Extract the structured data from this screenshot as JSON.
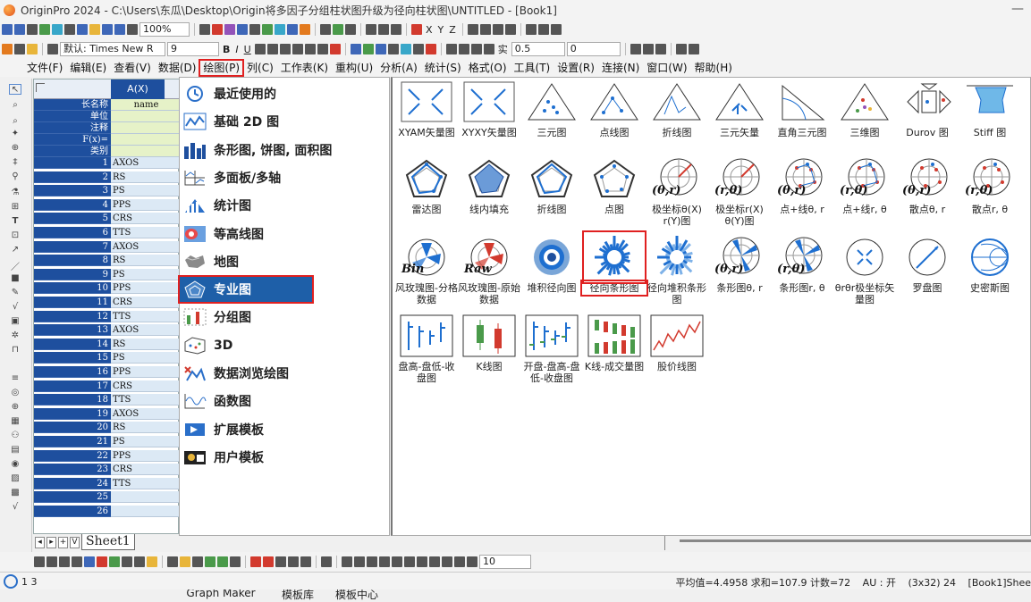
{
  "window": {
    "title": "OriginPro 2024 - C:\\Users\\东瓜\\Desktop\\Origin将多因子分组柱状图升级为径向柱状图\\UNTITLED - [Book1]",
    "minimize": "—"
  },
  "toolbar1": {
    "zoom": "100%",
    "text_items": [
      "X",
      "Y",
      "Z"
    ]
  },
  "toolbar2": {
    "font_name": "默认: Times New R",
    "font_size": "9",
    "bold": "B",
    "italic": "I",
    "underline": "U",
    "line_label": "实",
    "line_width": "0.5",
    "pattern_value": "0"
  },
  "menubar": {
    "items": [
      "文件(F)",
      "编辑(E)",
      "查看(V)",
      "数据(D)",
      "绘图(P)",
      "列(C)",
      "工作表(K)",
      "重构(U)",
      "分析(A)",
      "统计(S)",
      "格式(O)",
      "工具(T)",
      "设置(R)",
      "连接(N)",
      "窗口(W)",
      "帮助(H)"
    ],
    "active_index": 4
  },
  "sheet": {
    "column_header": "A(X)",
    "meta_rows": [
      {
        "label": "长名称",
        "value": "name"
      },
      {
        "label": "单位",
        "value": ""
      },
      {
        "label": "注释",
        "value": ""
      },
      {
        "label": "F(x)=",
        "value": ""
      },
      {
        "label": "类别",
        "value": ""
      }
    ],
    "rows": [
      {
        "n": "1",
        "v": "AXOS"
      },
      {
        "n": "2",
        "v": "RS"
      },
      {
        "n": "3",
        "v": "PS"
      },
      {
        "n": "4",
        "v": "PPS"
      },
      {
        "n": "5",
        "v": "CRS"
      },
      {
        "n": "6",
        "v": "TTS"
      },
      {
        "n": "7",
        "v": "AXOS"
      },
      {
        "n": "8",
        "v": "RS"
      },
      {
        "n": "9",
        "v": "PS"
      },
      {
        "n": "10",
        "v": "PPS"
      },
      {
        "n": "11",
        "v": "CRS"
      },
      {
        "n": "12",
        "v": "TTS"
      },
      {
        "n": "13",
        "v": "AXOS"
      },
      {
        "n": "14",
        "v": "RS"
      },
      {
        "n": "15",
        "v": "PS"
      },
      {
        "n": "16",
        "v": "PPS"
      },
      {
        "n": "17",
        "v": "CRS"
      },
      {
        "n": "18",
        "v": "TTS"
      },
      {
        "n": "19",
        "v": "AXOS"
      },
      {
        "n": "20",
        "v": "RS"
      },
      {
        "n": "21",
        "v": "PS"
      },
      {
        "n": "22",
        "v": "PPS"
      },
      {
        "n": "23",
        "v": "CRS"
      },
      {
        "n": "24",
        "v": "TTS"
      },
      {
        "n": "25",
        "v": ""
      },
      {
        "n": "26",
        "v": ""
      }
    ],
    "tab_name": "Sheet1",
    "nav_buttons": [
      "◂",
      "▸",
      "+",
      "V"
    ]
  },
  "categories": [
    {
      "label": "最近使用的",
      "icon": "clock-icon"
    },
    {
      "label": "基础 2D 图",
      "icon": "line-chart-icon"
    },
    {
      "label": "条形图, 饼图, 面积图",
      "icon": "bar-chart-icon"
    },
    {
      "label": "多面板/多轴",
      "icon": "multi-panel-icon"
    },
    {
      "label": "统计图",
      "icon": "statistics-icon"
    },
    {
      "label": "等高线图",
      "icon": "contour-icon"
    },
    {
      "label": "地图",
      "icon": "map-icon"
    },
    {
      "label": "专业图",
      "icon": "pentagon-icon"
    },
    {
      "label": "分组图",
      "icon": "group-icon"
    },
    {
      "label": "3D",
      "icon": "3d-icon"
    },
    {
      "label": "数据浏览绘图",
      "icon": "browse-icon"
    },
    {
      "label": "函数图",
      "icon": "function-icon"
    },
    {
      "label": "扩展模板",
      "icon": "extension-icon"
    },
    {
      "label": "用户模板",
      "icon": "user-template-icon"
    }
  ],
  "active_category_index": 7,
  "bottom_links": [
    {
      "label": "Graph Maker",
      "icon": "graph-maker-icon"
    },
    {
      "label": "模板库",
      "icon": "template-library-icon"
    },
    {
      "label": "模板中心",
      "icon": "cloud-icon"
    }
  ],
  "gallery": [
    {
      "label": "XYAM矢量图",
      "icon": "xyam-vector-icon"
    },
    {
      "label": "XYXY矢量图",
      "icon": "xyxy-vector-icon"
    },
    {
      "label": "三元图",
      "icon": "ternary-icon"
    },
    {
      "label": "点线图",
      "icon": "point-line-icon"
    },
    {
      "label": "折线图",
      "icon": "polyline-icon"
    },
    {
      "label": "三元矢量",
      "icon": "ternary-vector-icon"
    },
    {
      "label": "直角三元图",
      "icon": "right-ternary-icon"
    },
    {
      "label": "三维图",
      "icon": "ternary-3d-icon"
    },
    {
      "label": "Durov 图",
      "icon": "durov-icon"
    },
    {
      "label": "Stiff 图",
      "icon": "stiff-icon"
    },
    {
      "label": "雷达图",
      "icon": "radar-icon"
    },
    {
      "label": "线内填充",
      "icon": "radar-fill-icon"
    },
    {
      "label": "折线图",
      "icon": "radar-line-icon"
    },
    {
      "label": "点图",
      "icon": "radar-dot-icon"
    },
    {
      "label": "极坐标θ(X) r(Y)图",
      "icon": "polar-theta-r-icon",
      "overlay": "(θ,r)"
    },
    {
      "label": "极坐标r(X) θ(Y)图",
      "icon": "polar-r-theta-icon",
      "overlay": "(r,θ)"
    },
    {
      "label": "点+线θ, r",
      "icon": "polar-point-line-icon",
      "overlay": "(θ,r)"
    },
    {
      "label": "点+线r, θ",
      "icon": "polar-point-line-r-icon",
      "overlay": "(r,θ)"
    },
    {
      "label": "散点θ, r",
      "icon": "polar-scatter-icon",
      "overlay": "(θ,r)"
    },
    {
      "label": "散点r, θ",
      "icon": "polar-scatter-r-icon",
      "overlay": "(r,θ)"
    },
    {
      "label": "风玫瑰图-分格数据",
      "icon": "wind-rose-bin-icon",
      "overlay": "Bin"
    },
    {
      "label": "风玫瑰图-原始数据",
      "icon": "wind-rose-raw-icon",
      "overlay": "Raw"
    },
    {
      "label": "堆积径向图",
      "icon": "stacked-radial-icon"
    },
    {
      "label": "径向条形图",
      "icon": "radial-bar-icon"
    },
    {
      "label": "径向堆积条形图",
      "icon": "radial-stacked-bar-icon"
    },
    {
      "label": "条形图θ, r",
      "icon": "polar-bar-theta-r-icon",
      "overlay": "(θ,r)"
    },
    {
      "label": "条形图r, θ",
      "icon": "polar-bar-r-theta-icon",
      "overlay": "(r,θ)"
    },
    {
      "label": "θrθr极坐标矢量图",
      "icon": "polar-vector-icon"
    },
    {
      "label": "罗盘图",
      "icon": "compass-icon"
    },
    {
      "label": "史密斯图",
      "icon": "smith-chart-icon"
    },
    {
      "label": "盘高-盘低-收盘图",
      "icon": "hlc-icon"
    },
    {
      "label": "K线图",
      "icon": "candlestick-icon"
    },
    {
      "label": "开盘-盘高-盘低-收盘图",
      "icon": "ohlc-icon"
    },
    {
      "label": "K线-成交量图",
      "icon": "candle-volume-icon"
    },
    {
      "label": "股价线图",
      "icon": "stock-line-icon"
    }
  ],
  "selected_gallery_index": 23,
  "bottom_toolbar": {
    "font_size": "10"
  },
  "status": {
    "left": "1 3",
    "stats": "平均值=4.4958 求和=107.9 计数=72",
    "au": "AU : 开",
    "dims": "(3x32) 24",
    "sheet_ref": "[Book1]Shee"
  },
  "colors": {
    "accent_blue": "#1e5fa8",
    "sheet_label_bg": "#1e4f9e",
    "highlight_red": "#e02020",
    "meta_green": "#e6f2c8"
  }
}
